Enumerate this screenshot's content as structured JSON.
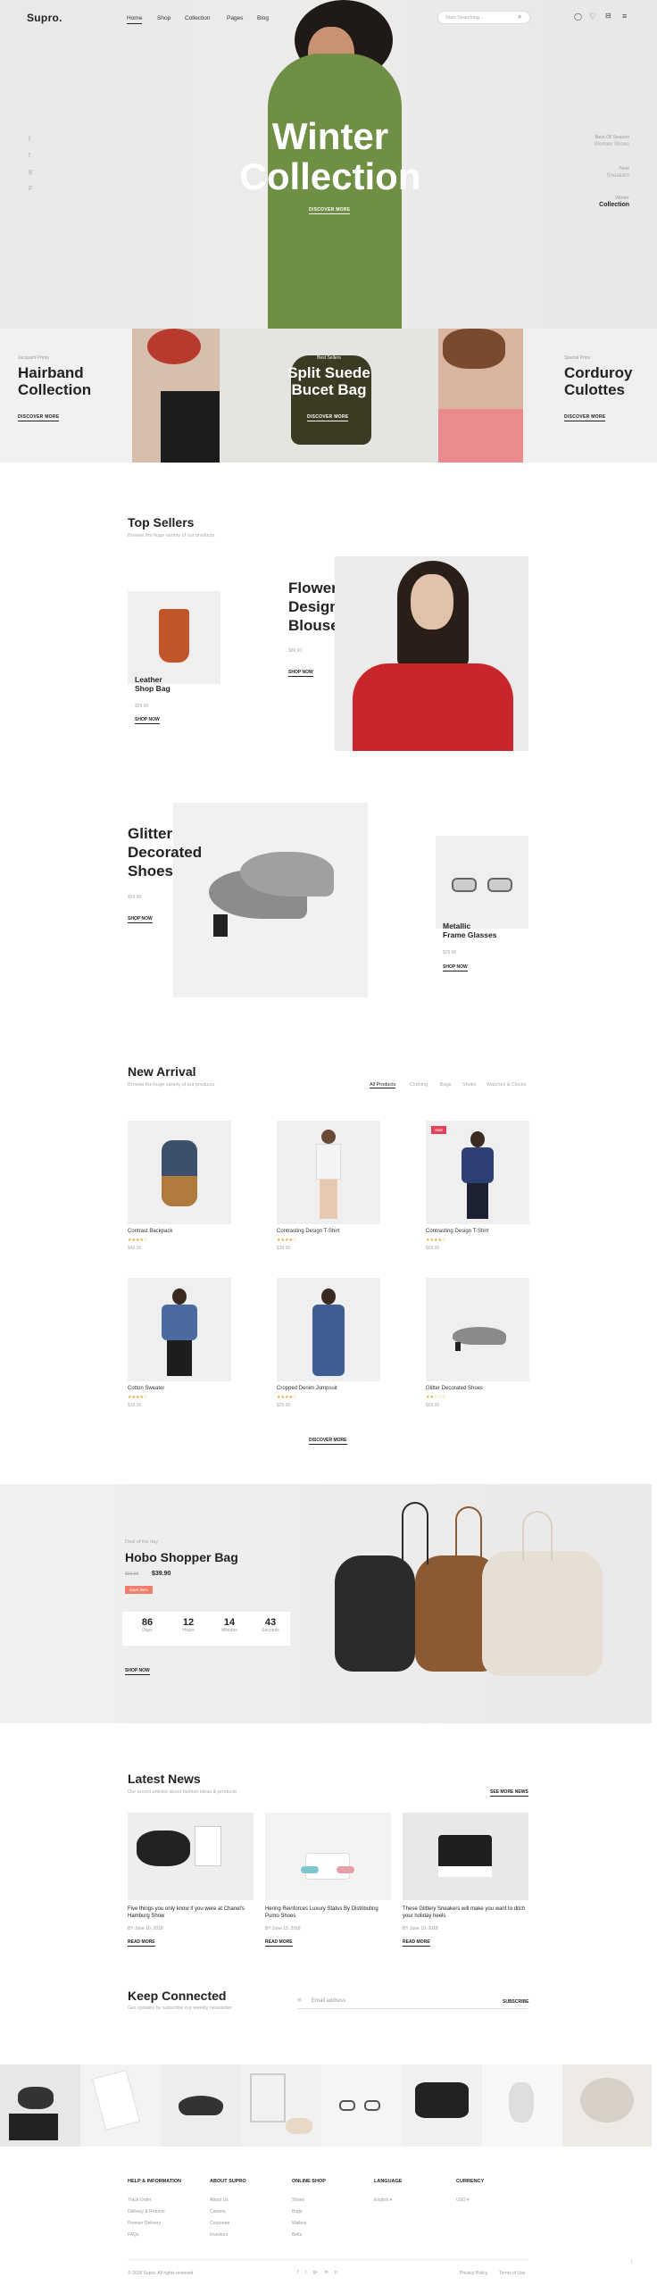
{
  "brand": {
    "logo": "Supro."
  },
  "nav": [
    "Home",
    "Shop",
    "Collection",
    "Pages",
    "Blog"
  ],
  "search": {
    "placeholder": "Start Searching..."
  },
  "hero": {
    "title_line1": "Winter",
    "title_line2": "Collection",
    "cta": "DISCOVER MORE",
    "side": [
      {
        "small": "Best Of Season",
        "big": "Women Shoes"
      },
      {
        "small": "New",
        "big": "Sneakers"
      },
      {
        "small": "Winter",
        "big": "Collection"
      }
    ]
  },
  "banners": [
    {
      "tag": "Jacquard Prints",
      "title_line1": "Hairband",
      "title_line2": "Collection",
      "cta": "DISCOVER MORE"
    },
    {
      "tag": "Best Sellers",
      "title_line1": "Split Suede",
      "title_line2": "Bucet Bag",
      "cta": "DISCOVER MORE"
    },
    {
      "tag": "Special Price",
      "title_line1": "Corduroy",
      "title_line2": "Culottes",
      "cta": "DISCOVER MORE"
    }
  ],
  "top_sellers": {
    "title": "Top Sellers",
    "subtitle": "Browse the huge variety of our products",
    "items": [
      {
        "name_line1": "Leather",
        "name_line2": "Shop Bag",
        "price": "$29.90",
        "cta": "SHOP NOW"
      },
      {
        "name_line1": "Flower",
        "name_line2": "Design",
        "name_line3": "Blouse",
        "price": "$89.90",
        "cta": "SHOP NOW"
      },
      {
        "name_line1": "Glitter",
        "name_line2": "Decorated",
        "name_line3": "Shoes",
        "price": "$59.90",
        "cta": "SHOP NOW"
      },
      {
        "name_line1": "Metallic",
        "name_line2": "Frame Glasses",
        "price": "$29.90",
        "cta": "SHOP NOW"
      }
    ]
  },
  "new_arrival": {
    "title": "New Arrival",
    "subtitle": "Browse the huge variety of our products",
    "filters": [
      "All Products",
      "Clothing",
      "Bags",
      "Shoes",
      "Watches & Clocks"
    ],
    "products": [
      {
        "name": "Contrast Backpack",
        "price": "$49.90",
        "rating": "★★★★☆"
      },
      {
        "name": "Contrasting Design T-Shirt",
        "price": "$39.90",
        "rating": "★★★★☆"
      },
      {
        "name": "Contrasting Design T-Shirt",
        "price": "$59.90",
        "rating": "★★★★☆",
        "badge": "Sale"
      },
      {
        "name": "Cotton Sweater",
        "price": "$19.90",
        "rating": "★★★★☆"
      },
      {
        "name": "Cropped Denim Jumpsuit",
        "price": "$29.90",
        "rating": "★★★★☆"
      },
      {
        "name": "Glitter Decorated Shoes",
        "price": "$59.90",
        "rating": "★★☆☆☆"
      }
    ],
    "cta": "DISCOVER MORE"
  },
  "deal": {
    "tag": "Deal of the day",
    "title": "Hobo Shopper Bag",
    "old_price": "$59.90",
    "price": "$39.90",
    "badge": "Save 35%",
    "countdown": [
      {
        "value": "86",
        "unit": "Days"
      },
      {
        "value": "12",
        "unit": "Hours"
      },
      {
        "value": "14",
        "unit": "Minutes"
      },
      {
        "value": "43",
        "unit": "Seconds"
      }
    ],
    "cta": "SHOP NOW"
  },
  "news": {
    "title": "Latest News",
    "subtitle": "Our recent articles about fashion ideas & products",
    "see_more": "SEE MORE NEWS",
    "posts": [
      {
        "title": "Five things you only know if you were at Chanel's Hamburg Show",
        "meta": "BY  June 10, 2018",
        "cta": "READ MORE"
      },
      {
        "title": "Hering Reinforces Luxury Status By Distributing Pumo Shoes",
        "meta": "BY  June 10, 2018",
        "cta": "READ MORE"
      },
      {
        "title": "These Glittery Sneakers will make you want to ditch your holiday heels",
        "meta": "BY  June 10, 2018",
        "cta": "READ MORE"
      }
    ]
  },
  "newsletter": {
    "title": "Keep Connected",
    "subtitle": "Get updates by subscribe our weekly newsletter",
    "placeholder": "Email address",
    "button": "SUBSCRIBE"
  },
  "footer": {
    "columns": [
      {
        "title": "HELP & INFORMATION",
        "links": [
          "Track Order",
          "Delivery & Returns",
          "Premier Delivery",
          "FAQs"
        ]
      },
      {
        "title": "ABOUT SUPRO",
        "links": [
          "About Us",
          "Careers",
          "Corporate",
          "Investors"
        ]
      },
      {
        "title": "ONLINE SHOP",
        "links": [
          "Shoes",
          "Bags",
          "Wallets",
          "Belts"
        ]
      },
      {
        "title": "LANGUAGE",
        "links": [
          "English ▾"
        ]
      },
      {
        "title": "CURRENCY",
        "links": [
          "USD ▾"
        ]
      }
    ],
    "copyright": "© 2018 Supro. All rights reserved",
    "social": [
      "f",
      "t",
      "g+",
      "in",
      "p"
    ],
    "legal": [
      "Privacy Policy",
      "Terms of Use"
    ]
  },
  "colors": {
    "accent": "#e8a33a",
    "sale": "#e0405a",
    "badge": "#f07e6e"
  }
}
